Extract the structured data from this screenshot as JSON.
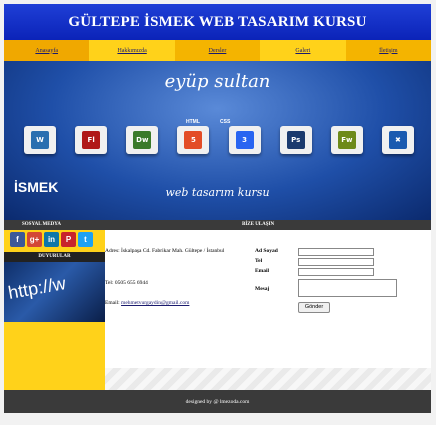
{
  "header": {
    "title": "GÜLTEPE İSMEK WEB TASARIM KURSU"
  },
  "nav": {
    "items": [
      "Anasayfa",
      "Hakkımızda",
      "Dersler",
      "Galeri",
      "İletişim"
    ]
  },
  "banner": {
    "logo": "eyüp sultan",
    "tiles": [
      {
        "name": "wordpress-icon",
        "label": "W",
        "color": "#2a6fb0"
      },
      {
        "name": "flash-icon",
        "label": "Fl",
        "color": "#b01818"
      },
      {
        "name": "dreamweaver-icon",
        "label": "Dw",
        "color": "#3a7a2a"
      },
      {
        "name": "html5-icon",
        "label": "5",
        "color": "#e34c26"
      },
      {
        "name": "css3-icon",
        "label": "3",
        "color": "#2965f1"
      },
      {
        "name": "photoshop-icon",
        "label": "Ps",
        "color": "#1b3a6e"
      },
      {
        "name": "fireworks-icon",
        "label": "Fw",
        "color": "#6e8a1a"
      },
      {
        "name": "joomla-icon",
        "label": "✖",
        "color": "#1a5ab0"
      }
    ],
    "tile_heading_1": "HTML",
    "tile_heading_2": "CSS",
    "footer_logo": "İSMEK",
    "tagline": "web tasarım kursu"
  },
  "bar": {
    "social_title": "SOSYAL MEDYA",
    "contact_title": "BİZE ULAŞIN"
  },
  "sidebar": {
    "social": [
      {
        "name": "facebook-icon",
        "label": "f",
        "color": "#3b5998"
      },
      {
        "name": "google-plus-icon",
        "label": "g+",
        "color": "#d34836"
      },
      {
        "name": "linkedin-icon",
        "label": "in",
        "color": "#0e76a8"
      },
      {
        "name": "pinterest-icon",
        "label": "P",
        "color": "#c8232c"
      },
      {
        "name": "twitter-icon",
        "label": "t",
        "color": "#1da1f2"
      }
    ],
    "announcements_title": "DUYURULAR",
    "image_text": "http://w"
  },
  "contact": {
    "address": "Adres: İskalpaşa Cd. Fabrikar Mah. Gültepe / İstanbul",
    "tel": "Tel: 0505 655 6944",
    "email_label": "Email:",
    "email_value": "mehmetvurgaydin@gmail.com"
  },
  "form": {
    "name_label": "Ad Soyad",
    "tel_label": "Tel",
    "email_label": "Email",
    "message_label": "Mesaj",
    "submit_label": "Gönder"
  },
  "footer": {
    "prefix": "designed by ",
    "credit": "@ lmezoda.com"
  }
}
